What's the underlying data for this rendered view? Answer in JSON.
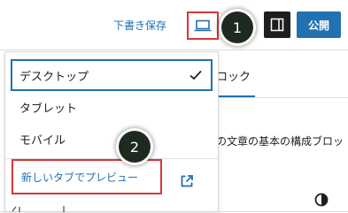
{
  "header": {
    "draft_save_label": "下書き保存",
    "publish_label": "公開",
    "device_preview_icon": "laptop-icon",
    "sidebar_toggle_icon": "sidebar-panel-icon"
  },
  "markers": {
    "first": "1",
    "second": "2"
  },
  "background": {
    "tab_label": "ロック",
    "description": "の文章の基本の構成ブロッ"
  },
  "preview_menu": {
    "items": [
      {
        "label": "デスクトップ",
        "selected": true
      },
      {
        "label": "タブレット",
        "selected": false
      },
      {
        "label": "モバイル",
        "selected": false
      }
    ],
    "open_new_tab_label": "新しいタブでプレビュー",
    "open_new_tab_icon": "external-link-icon",
    "selected_icon": "check-icon"
  },
  "colors": {
    "accent": "#2271b1",
    "highlight_red": "#d63638",
    "dark": "#1e1e1e"
  }
}
